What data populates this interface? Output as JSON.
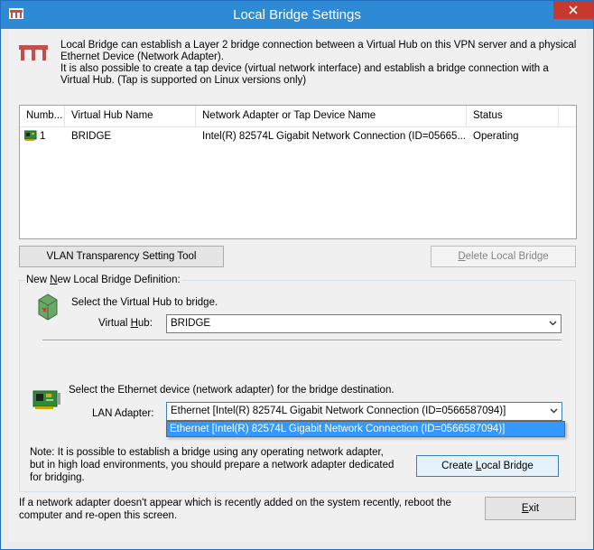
{
  "window": {
    "title": "Local Bridge Settings"
  },
  "intro": {
    "lines": [
      "Local Bridge can establish a Layer 2 bridge connection between a Virtual Hub on this VPN server and a physical",
      "Ethernet Device (Network Adapter).",
      "It is also possible to create a tap device (virtual network interface) and establish a bridge connection with a",
      "Virtual Hub. (Tap is supported on Linux versions only)"
    ]
  },
  "bridge_table": {
    "columns": [
      "Numb...",
      "Virtual Hub Name",
      "Network Adapter or Tap Device Name",
      "Status"
    ],
    "rows": [
      {
        "number": "1",
        "hub": "BRIDGE",
        "adapter": "Intel(R) 82574L Gigabit Network Connection (ID=05665...",
        "status": "Operating"
      }
    ]
  },
  "buttons": {
    "vlan_tool": "VLAN Transparency Setting Tool",
    "delete_prefix": "D",
    "delete_rest": "elete Local Bridge",
    "create_prefix": "Create ",
    "create_accel": "L",
    "create_rest": "ocal Bridge",
    "exit_accel": "E",
    "exit_rest": "xit"
  },
  "group": {
    "title_prefix": "New ",
    "title_accel": "N",
    "title_rest": "ew Local Bridge Definition:",
    "hub_prompt": "Select the Virtual Hub to bridge.",
    "hub_label_prefix": "Virtual ",
    "hub_label_accel": "H",
    "hub_label_rest": "ub:",
    "hub_value": "BRIDGE",
    "eth_prompt": "Select the Ethernet device (network adapter) for the bridge destination.",
    "lan_label": "LAN Adapter:",
    "lan_value": "Ethernet [Intel(R) 82574L Gigabit Network Connection (ID=0566587094)]",
    "lan_options": [
      "Ethernet [Intel(R) 82574L Gigabit Network Connection (ID=0566587094)]"
    ],
    "note_lines": [
      "Note: It is possible to establish a bridge using any operating network adapter,",
      "but in high load environments, you should prepare a network adapter dedicated",
      "for bridging."
    ]
  },
  "footer": {
    "lines": [
      "If a network adapter doesn't appear which is recently added on the system recently, reboot the",
      "computer and re-open this screen."
    ]
  },
  "colors": {
    "titlebar": "#2f8ad6",
    "close": "#c7382f",
    "selection": "#3399ff"
  }
}
